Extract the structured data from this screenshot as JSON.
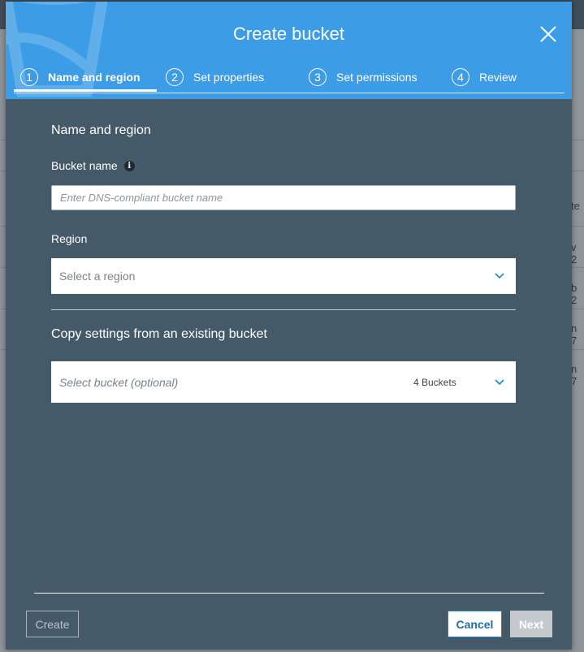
{
  "background": {
    "fragments": [
      "te",
      "v 2",
      "b 2",
      "n 7",
      "n 7"
    ]
  },
  "modal": {
    "title": "Create bucket",
    "steps": [
      {
        "number": "1",
        "label": "Name and region",
        "active": true
      },
      {
        "number": "2",
        "label": "Set properties",
        "active": false
      },
      {
        "number": "3",
        "label": "Set permissions",
        "active": false
      },
      {
        "number": "4",
        "label": "Review",
        "active": false
      }
    ],
    "section_title": "Name and region",
    "bucket_name": {
      "label": "Bucket name",
      "info_icon": "i",
      "value": "",
      "placeholder": "Enter DNS-compliant bucket name"
    },
    "region": {
      "label": "Region",
      "selected": "Select a region"
    },
    "copy_settings": {
      "title": "Copy settings from an existing bucket",
      "selected": "Select bucket (optional)",
      "count": "4 Buckets"
    },
    "buttons": {
      "create": "Create",
      "cancel": "Cancel",
      "next": "Next"
    }
  },
  "colors": {
    "header": "#3d9ce6",
    "body": "#455a68",
    "accent": "#1e88c7"
  }
}
